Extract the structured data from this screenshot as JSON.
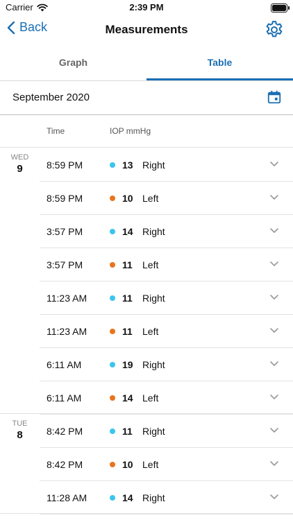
{
  "status_bar": {
    "carrier": "Carrier",
    "time": "2:39 PM"
  },
  "navbar": {
    "back_label": "Back",
    "title": "Measurements"
  },
  "tabs": [
    {
      "label": "Graph",
      "active": false
    },
    {
      "label": "Table",
      "active": true
    }
  ],
  "month_label": "September 2020",
  "columns": {
    "time": "Time",
    "iop": "IOP mmHg"
  },
  "colors": {
    "accent": "#1a6fb3",
    "right_eye": "#3cc4ef",
    "left_eye": "#e8741e"
  },
  "days": [
    {
      "dow": "WED",
      "num": "9",
      "rows": [
        {
          "time": "8:59 PM",
          "value": "13",
          "eye": "Right"
        },
        {
          "time": "8:59 PM",
          "value": "10",
          "eye": "Left"
        },
        {
          "time": "3:57 PM",
          "value": "14",
          "eye": "Right"
        },
        {
          "time": "3:57 PM",
          "value": "11",
          "eye": "Left"
        },
        {
          "time": "11:23 AM",
          "value": "11",
          "eye": "Right"
        },
        {
          "time": "11:23 AM",
          "value": "11",
          "eye": "Left"
        },
        {
          "time": "6:11 AM",
          "value": "19",
          "eye": "Right"
        },
        {
          "time": "6:11 AM",
          "value": "14",
          "eye": "Left"
        }
      ]
    },
    {
      "dow": "TUE",
      "num": "8",
      "rows": [
        {
          "time": "8:42 PM",
          "value": "11",
          "eye": "Right"
        },
        {
          "time": "8:42 PM",
          "value": "10",
          "eye": "Left"
        },
        {
          "time": "11:28 AM",
          "value": "14",
          "eye": "Right"
        }
      ]
    }
  ]
}
